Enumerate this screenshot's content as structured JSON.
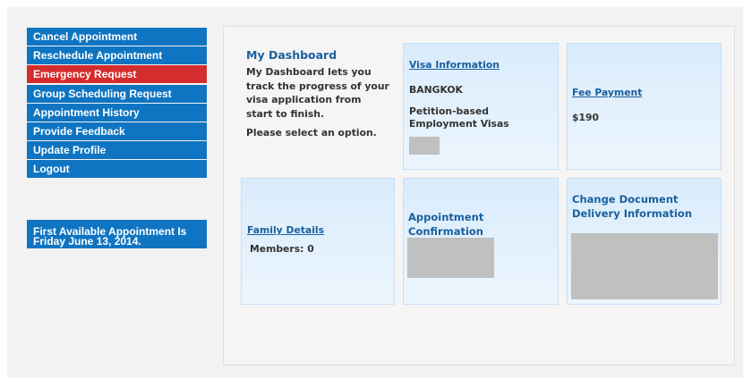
{
  "sidebar": {
    "items": [
      {
        "label": "Cancel Appointment",
        "active": false
      },
      {
        "label": "Reschedule Appointment",
        "active": false
      },
      {
        "label": "Emergency Request",
        "active": true
      },
      {
        "label": "Group Scheduling Request",
        "active": false
      },
      {
        "label": "Appointment History",
        "active": false
      },
      {
        "label": "Provide Feedback",
        "active": false
      },
      {
        "label": "Update Profile",
        "active": false
      },
      {
        "label": "Logout",
        "active": false
      }
    ],
    "notice_line1": "First Available Appointment Is",
    "notice_line2": "Friday June 13, 2014."
  },
  "dashboard": {
    "title": "My Dashboard",
    "description": "My Dashboard lets you track the progress of your visa application from start to finish.",
    "prompt": "Please select an option."
  },
  "cards": {
    "visa": {
      "title": "Visa Information",
      "city": "BANGKOK",
      "visa_type": "Petition-based Employment Visas"
    },
    "fee": {
      "title": "Fee Payment",
      "amount": "$190"
    },
    "family": {
      "title": "Family Details",
      "members": "Members: 0"
    },
    "appointment": {
      "title": "Appointment Confirmation"
    },
    "delivery": {
      "title": "Change Document Delivery Information"
    }
  },
  "colors": {
    "menu": "#0f75c2",
    "menu_active": "#d42d2d",
    "link": "#1a5f9e",
    "card_top": "#d9ecfc",
    "placeholder": "#c0c0c0"
  }
}
